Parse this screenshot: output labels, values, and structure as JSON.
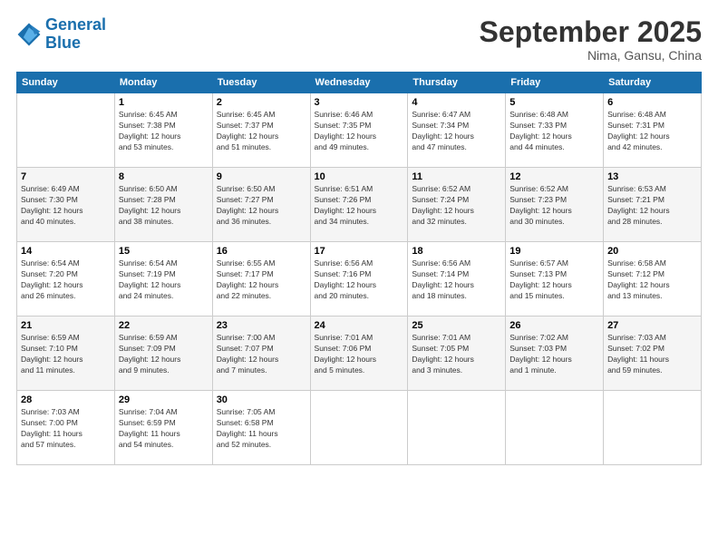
{
  "header": {
    "logo_line1": "General",
    "logo_line2": "Blue",
    "month": "September 2025",
    "location": "Nima, Gansu, China"
  },
  "columns": [
    "Sunday",
    "Monday",
    "Tuesday",
    "Wednesday",
    "Thursday",
    "Friday",
    "Saturday"
  ],
  "weeks": [
    [
      {
        "day": "",
        "info": ""
      },
      {
        "day": "1",
        "info": "Sunrise: 6:45 AM\nSunset: 7:38 PM\nDaylight: 12 hours\nand 53 minutes."
      },
      {
        "day": "2",
        "info": "Sunrise: 6:45 AM\nSunset: 7:37 PM\nDaylight: 12 hours\nand 51 minutes."
      },
      {
        "day": "3",
        "info": "Sunrise: 6:46 AM\nSunset: 7:35 PM\nDaylight: 12 hours\nand 49 minutes."
      },
      {
        "day": "4",
        "info": "Sunrise: 6:47 AM\nSunset: 7:34 PM\nDaylight: 12 hours\nand 47 minutes."
      },
      {
        "day": "5",
        "info": "Sunrise: 6:48 AM\nSunset: 7:33 PM\nDaylight: 12 hours\nand 44 minutes."
      },
      {
        "day": "6",
        "info": "Sunrise: 6:48 AM\nSunset: 7:31 PM\nDaylight: 12 hours\nand 42 minutes."
      }
    ],
    [
      {
        "day": "7",
        "info": "Sunrise: 6:49 AM\nSunset: 7:30 PM\nDaylight: 12 hours\nand 40 minutes."
      },
      {
        "day": "8",
        "info": "Sunrise: 6:50 AM\nSunset: 7:28 PM\nDaylight: 12 hours\nand 38 minutes."
      },
      {
        "day": "9",
        "info": "Sunrise: 6:50 AM\nSunset: 7:27 PM\nDaylight: 12 hours\nand 36 minutes."
      },
      {
        "day": "10",
        "info": "Sunrise: 6:51 AM\nSunset: 7:26 PM\nDaylight: 12 hours\nand 34 minutes."
      },
      {
        "day": "11",
        "info": "Sunrise: 6:52 AM\nSunset: 7:24 PM\nDaylight: 12 hours\nand 32 minutes."
      },
      {
        "day": "12",
        "info": "Sunrise: 6:52 AM\nSunset: 7:23 PM\nDaylight: 12 hours\nand 30 minutes."
      },
      {
        "day": "13",
        "info": "Sunrise: 6:53 AM\nSunset: 7:21 PM\nDaylight: 12 hours\nand 28 minutes."
      }
    ],
    [
      {
        "day": "14",
        "info": "Sunrise: 6:54 AM\nSunset: 7:20 PM\nDaylight: 12 hours\nand 26 minutes."
      },
      {
        "day": "15",
        "info": "Sunrise: 6:54 AM\nSunset: 7:19 PM\nDaylight: 12 hours\nand 24 minutes."
      },
      {
        "day": "16",
        "info": "Sunrise: 6:55 AM\nSunset: 7:17 PM\nDaylight: 12 hours\nand 22 minutes."
      },
      {
        "day": "17",
        "info": "Sunrise: 6:56 AM\nSunset: 7:16 PM\nDaylight: 12 hours\nand 20 minutes."
      },
      {
        "day": "18",
        "info": "Sunrise: 6:56 AM\nSunset: 7:14 PM\nDaylight: 12 hours\nand 18 minutes."
      },
      {
        "day": "19",
        "info": "Sunrise: 6:57 AM\nSunset: 7:13 PM\nDaylight: 12 hours\nand 15 minutes."
      },
      {
        "day": "20",
        "info": "Sunrise: 6:58 AM\nSunset: 7:12 PM\nDaylight: 12 hours\nand 13 minutes."
      }
    ],
    [
      {
        "day": "21",
        "info": "Sunrise: 6:59 AM\nSunset: 7:10 PM\nDaylight: 12 hours\nand 11 minutes."
      },
      {
        "day": "22",
        "info": "Sunrise: 6:59 AM\nSunset: 7:09 PM\nDaylight: 12 hours\nand 9 minutes."
      },
      {
        "day": "23",
        "info": "Sunrise: 7:00 AM\nSunset: 7:07 PM\nDaylight: 12 hours\nand 7 minutes."
      },
      {
        "day": "24",
        "info": "Sunrise: 7:01 AM\nSunset: 7:06 PM\nDaylight: 12 hours\nand 5 minutes."
      },
      {
        "day": "25",
        "info": "Sunrise: 7:01 AM\nSunset: 7:05 PM\nDaylight: 12 hours\nand 3 minutes."
      },
      {
        "day": "26",
        "info": "Sunrise: 7:02 AM\nSunset: 7:03 PM\nDaylight: 12 hours\nand 1 minute."
      },
      {
        "day": "27",
        "info": "Sunrise: 7:03 AM\nSunset: 7:02 PM\nDaylight: 11 hours\nand 59 minutes."
      }
    ],
    [
      {
        "day": "28",
        "info": "Sunrise: 7:03 AM\nSunset: 7:00 PM\nDaylight: 11 hours\nand 57 minutes."
      },
      {
        "day": "29",
        "info": "Sunrise: 7:04 AM\nSunset: 6:59 PM\nDaylight: 11 hours\nand 54 minutes."
      },
      {
        "day": "30",
        "info": "Sunrise: 7:05 AM\nSunset: 6:58 PM\nDaylight: 11 hours\nand 52 minutes."
      },
      {
        "day": "",
        "info": ""
      },
      {
        "day": "",
        "info": ""
      },
      {
        "day": "",
        "info": ""
      },
      {
        "day": "",
        "info": ""
      }
    ]
  ]
}
